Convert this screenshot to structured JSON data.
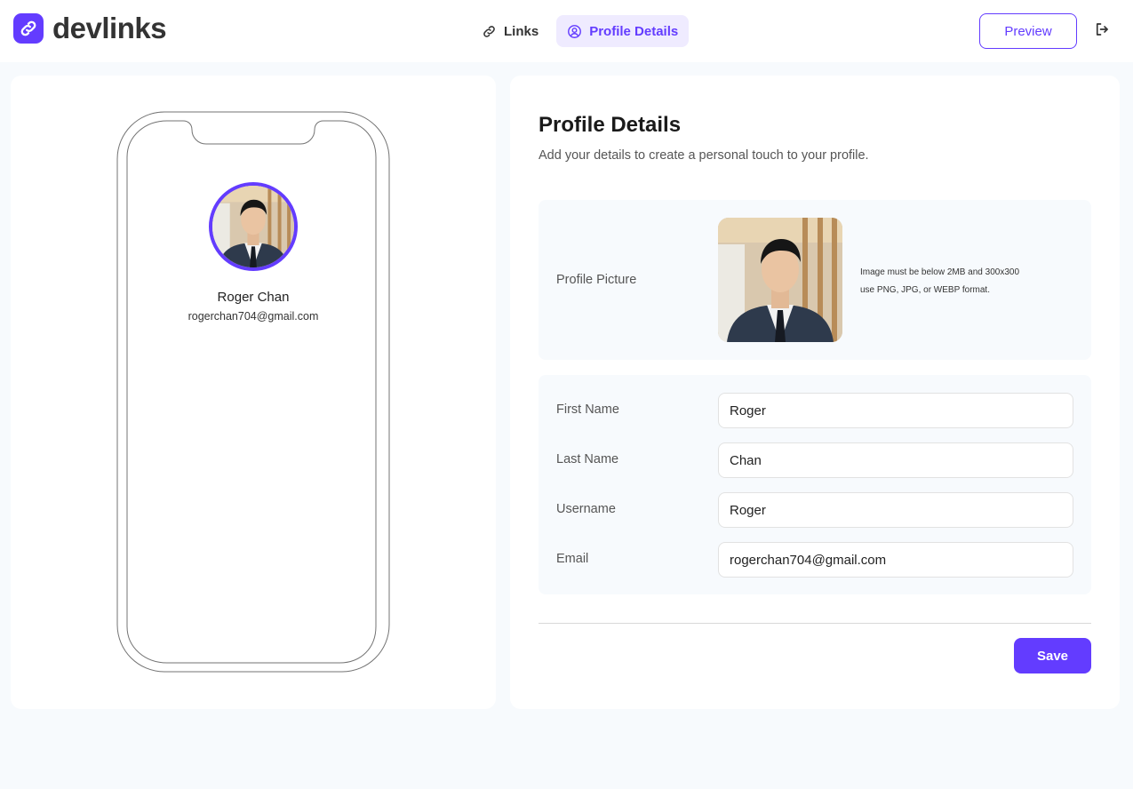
{
  "app": {
    "name": "devlinks",
    "brand_color": "#633CFF"
  },
  "nav": {
    "tabs": [
      {
        "label": "Links",
        "icon": "link-icon",
        "active": false
      },
      {
        "label": "Profile Details",
        "icon": "user-circle-icon",
        "active": true
      }
    ]
  },
  "header": {
    "preview_label": "Preview",
    "logout_icon": "logout-icon"
  },
  "preview": {
    "name": "Roger Chan",
    "email": "rogerchan704@gmail.com"
  },
  "form": {
    "title": "Profile Details",
    "subtitle": "Add your details to create a personal touch to your profile.",
    "profile_picture": {
      "label": "Profile Picture",
      "hint_line1": "Image must be below 2MB and 300x300",
      "hint_line2": "use PNG, JPG, or WEBP format."
    },
    "fields": [
      {
        "label": "First Name",
        "value": "Roger"
      },
      {
        "label": "Last Name",
        "value": "Chan"
      },
      {
        "label": "Username",
        "value": "Roger"
      },
      {
        "label": "Email",
        "value": "rogerchan704@gmail.com"
      }
    ],
    "save_label": "Save"
  }
}
